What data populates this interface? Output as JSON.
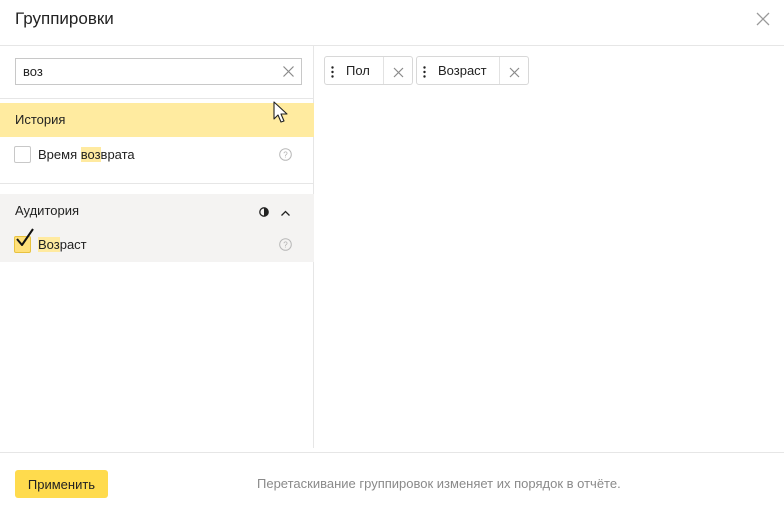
{
  "dialog": {
    "title": "Группировки"
  },
  "search": {
    "value": "воз"
  },
  "groups": [
    {
      "title": "История",
      "items": [
        {
          "label_parts": [
            "Время ",
            "воз",
            "врата"
          ],
          "checked": false
        }
      ]
    },
    {
      "title": "Аудитория",
      "items": [
        {
          "label_parts": [
            "",
            "Воз",
            "раст"
          ],
          "checked": true
        }
      ]
    }
  ],
  "selected_chips": [
    {
      "label": "Пол"
    },
    {
      "label": "Возраст"
    }
  ],
  "footer": {
    "apply_label": "Применить",
    "hint": "Перетаскивание группировок изменяет их порядок в отчёте."
  },
  "colors": {
    "accent": "#ffdb4d",
    "highlight": "#ffeaa0",
    "active_group_bg": "#ffeba0",
    "group_bg": "#f4f3f2"
  }
}
